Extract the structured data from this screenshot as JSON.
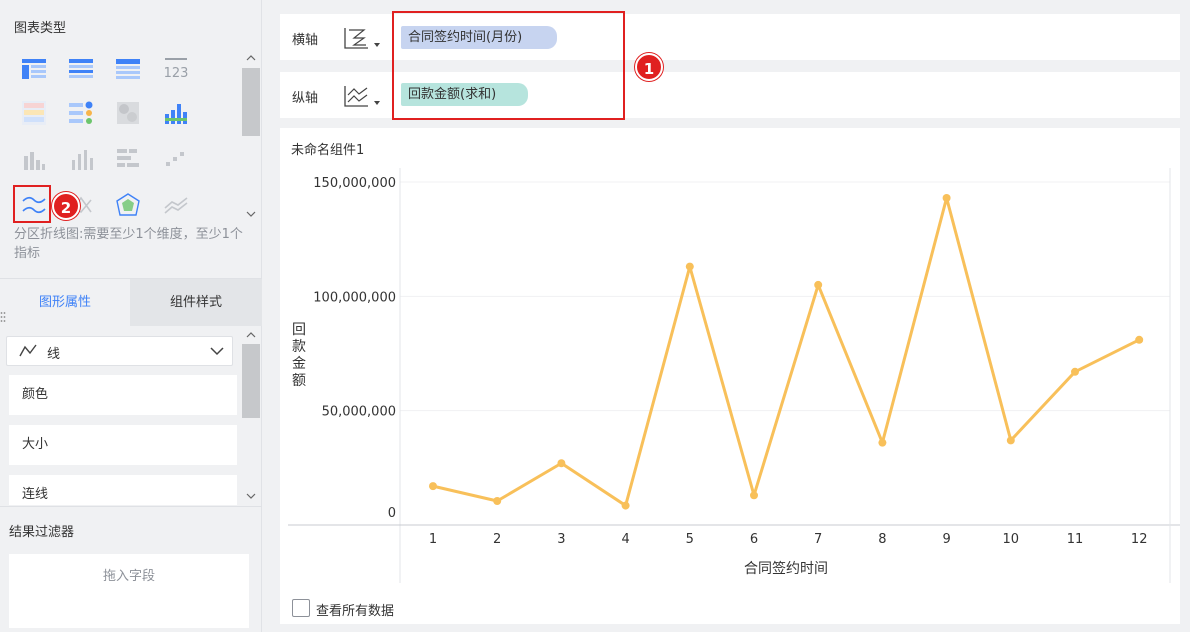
{
  "left_panel": {
    "chart_type_title": "图表类型",
    "chart_type_desc": "分区折线图:需要至少1个维度，至少1个指标",
    "tabs": {
      "active": "图形属性",
      "inactive": "组件样式"
    },
    "dropdown_label": "线",
    "properties": [
      "颜色",
      "大小",
      "连线"
    ],
    "filter_title": "结果过滤器",
    "filter_placeholder": "拖入字段"
  },
  "axes": {
    "x_label": "横轴",
    "x_field": "合同签约时间(月份)",
    "y_label": "纵轴",
    "y_field": "回款金额(求和)"
  },
  "badges": {
    "one": "1",
    "two": "2"
  },
  "chart_panel": {
    "title": "未命名组件1",
    "checkbox_label": "查看所有数据"
  },
  "colors": {
    "line": "#f8c05a",
    "accent": "#3f82f7",
    "highlight": "#e02020"
  },
  "chart_data": {
    "type": "line",
    "xlabel": "合同签约时间",
    "ylabel": "回款金额",
    "categories": [
      "1",
      "2",
      "3",
      "4",
      "5",
      "6",
      "7",
      "8",
      "9",
      "10",
      "11",
      "12"
    ],
    "series": [
      {
        "values": [
          17000000,
          10500000,
          27000000,
          8500000,
          113000000,
          13000000,
          105000000,
          36000000,
          143000000,
          37000000,
          67000000,
          81000000
        ]
      }
    ],
    "ylim": [
      0,
      150000000
    ],
    "yticks": [
      0,
      50000000,
      100000000,
      150000000
    ],
    "ytick_labels": [
      "0",
      "50,000,000",
      "100,000,000",
      "150,000,000"
    ]
  }
}
